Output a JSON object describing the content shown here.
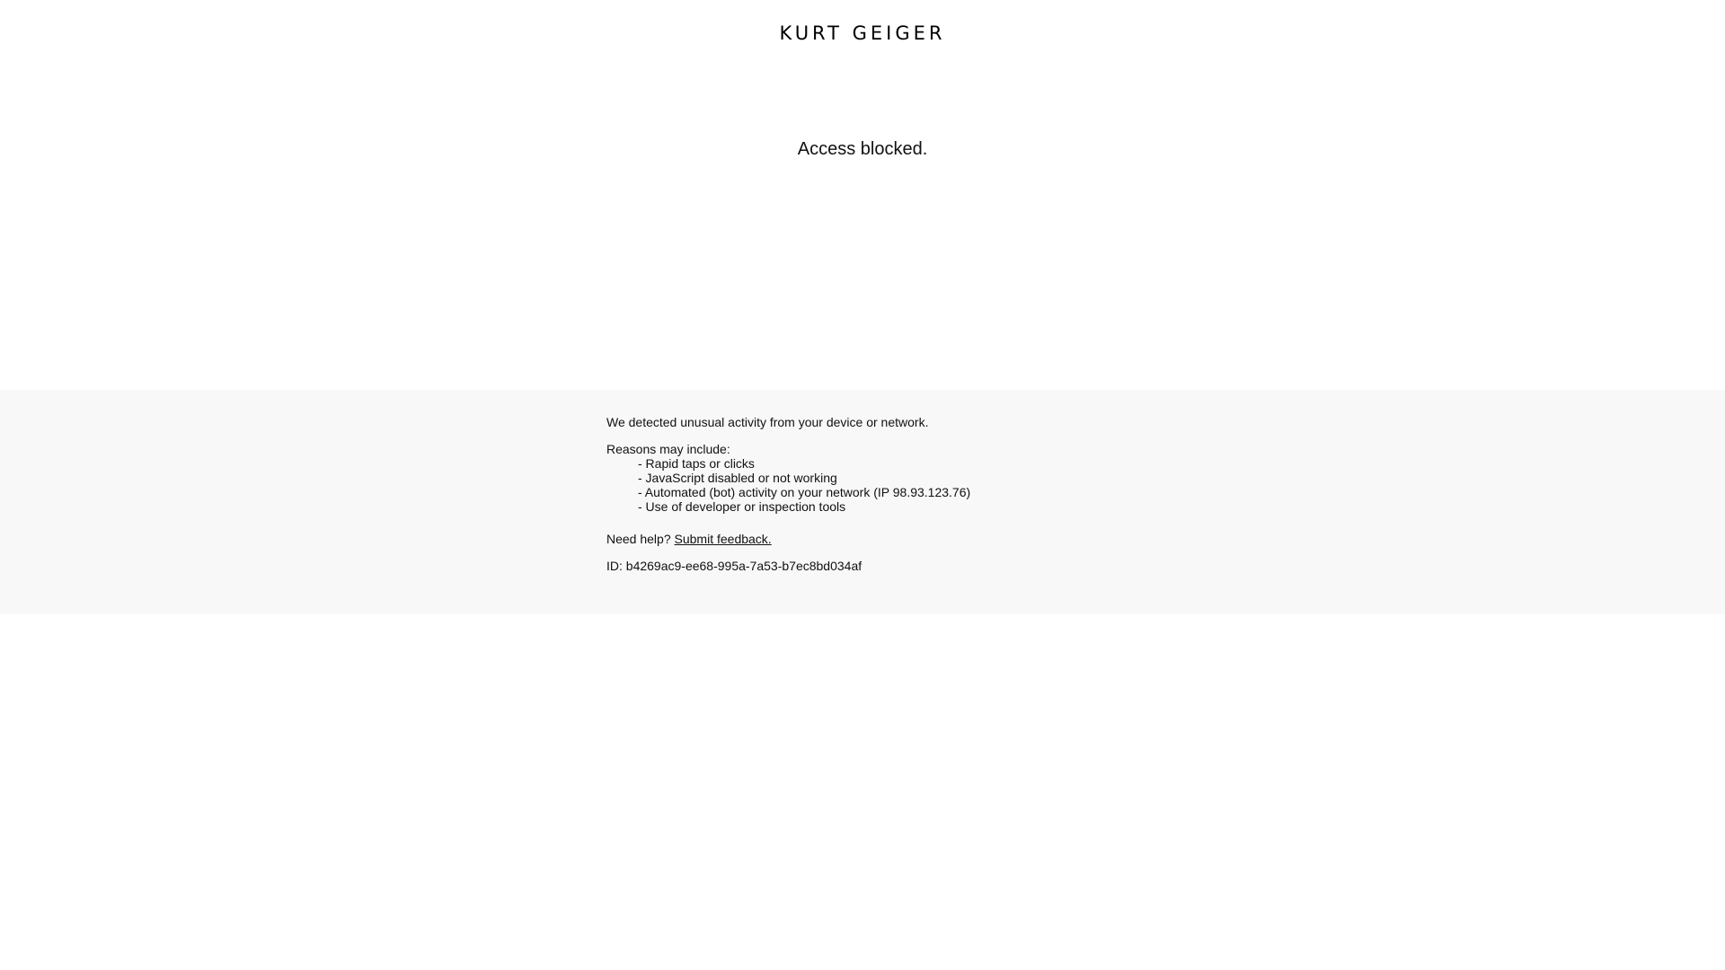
{
  "brand": {
    "logo_text": "KURT GEIGER"
  },
  "main": {
    "headline": "Access blocked."
  },
  "info": {
    "detected": "We detected unusual activity from your device or network.",
    "reasons_title": "Reasons may include:",
    "reasons": [
      "- Rapid taps or clicks",
      "- JavaScript disabled or not working",
      "- Automated (bot) activity on your network (IP 98.93.123.76)",
      "- Use of developer or inspection tools"
    ],
    "help_prefix": "Need help?",
    "help_link": "Submit feedback.",
    "id_label": "ID:",
    "id_value": "b4269ac9-ee68-995a-7a53-b7ec8bd034af"
  },
  "colors": {
    "background": "#ffffff",
    "info_band": "#f8f8f8",
    "text": "#111111"
  }
}
